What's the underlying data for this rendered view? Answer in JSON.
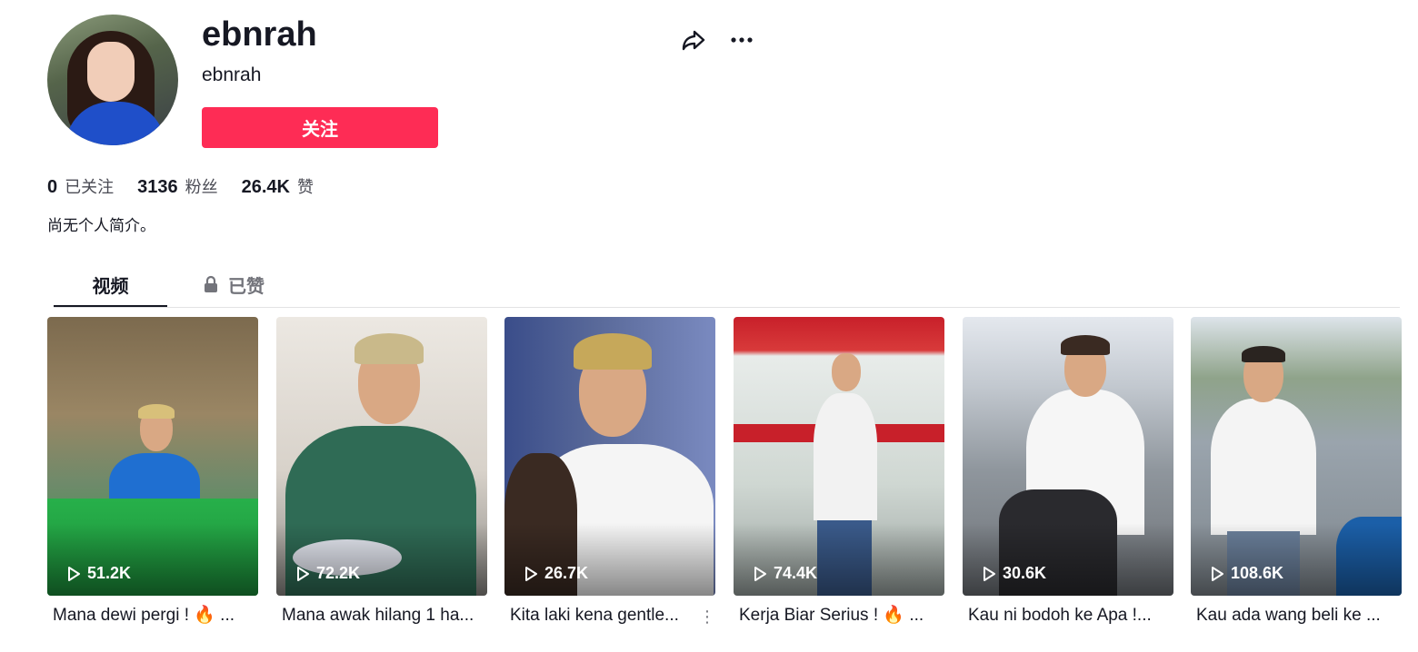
{
  "profile": {
    "display_name": "ebnrah",
    "username": "ebnrah",
    "follow_label": "关注",
    "bio": "尚无个人简介。"
  },
  "stats": {
    "following": {
      "count": "0",
      "label": "已关注"
    },
    "followers": {
      "count": "3136",
      "label": "粉丝"
    },
    "likes": {
      "count": "26.4K",
      "label": "赞"
    }
  },
  "tabs": [
    {
      "label": "视频",
      "active": true
    },
    {
      "label": "已赞",
      "active": false,
      "icon": "lock-icon"
    }
  ],
  "colors": {
    "accent": "#fe2c55",
    "text": "#161823",
    "muted": "#73747b"
  },
  "videos": [
    {
      "views": "51.2K",
      "caption": "Mana dewi pergi ! 🔥 ..."
    },
    {
      "views": "72.2K",
      "caption": "Mana awak hilang 1 ha..."
    },
    {
      "views": "26.7K",
      "caption": "Kita laki kena gentle..."
    },
    {
      "views": "74.4K",
      "caption": "Kerja Biar Serius ! 🔥 ..."
    },
    {
      "views": "30.6K",
      "caption": "Kau ni bodoh ke Apa !..."
    },
    {
      "views": "108.6K",
      "caption": "Kau ada wang beli ke ..."
    }
  ]
}
